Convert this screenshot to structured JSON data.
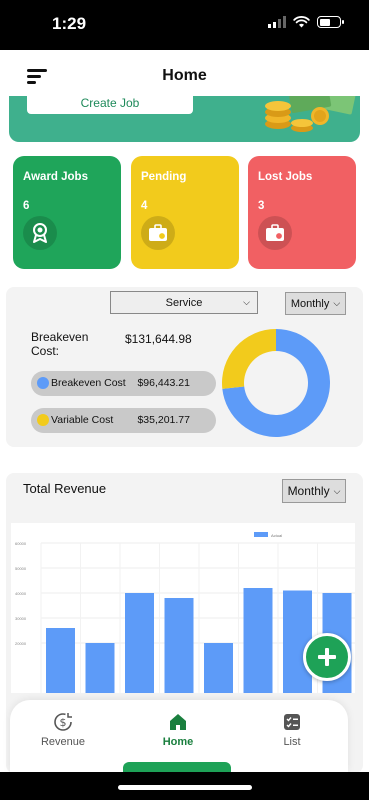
{
  "status_bar": {
    "time": "1:29"
  },
  "header": {
    "title": "Home"
  },
  "banner": {
    "create_job_label": "Create Job"
  },
  "cards": [
    {
      "title": "Award Jobs",
      "count": "6",
      "color": "#1fa55a",
      "icon": "award-icon"
    },
    {
      "title": "Pending",
      "count": "4",
      "color": "#f2cb1c",
      "icon": "briefcase-clock-icon"
    },
    {
      "title": "Lost Jobs",
      "count": "3",
      "color": "#f16063",
      "icon": "briefcase-x-icon"
    }
  ],
  "breakeven": {
    "service_select": "Service",
    "period_select": "Monthly",
    "label": "Breakeven Cost:",
    "total": "$131,644.98",
    "items": [
      {
        "label": "Breakeven Cost",
        "value": "$96,443.21",
        "color": "#5d9bf8"
      },
      {
        "label": "Variable Cost",
        "value": "$35,201.77",
        "color": "#f2cb1c"
      }
    ]
  },
  "donut": {
    "segments": [
      {
        "value": 96443.21,
        "color": "#5d9bf8"
      },
      {
        "value": 35201.77,
        "color": "#f2cb1c"
      }
    ]
  },
  "revenue": {
    "title": "Total Revenue",
    "period_select": "Monthly"
  },
  "chart_data": {
    "type": "bar",
    "legend": [
      "Actual"
    ],
    "legend_position": "top",
    "ytick_labels": [
      "60000",
      "50000",
      "40000",
      "30000",
      "20000"
    ],
    "ylim": [
      0,
      60000
    ],
    "grid": true,
    "series": [
      {
        "name": "Actual",
        "color": "#5d9bf8",
        "values": [
          26000,
          20000,
          40000,
          38000,
          20000,
          42000,
          41000,
          40000,
          36000
        ]
      }
    ]
  },
  "tabbar": {
    "items": [
      {
        "label": "Revenue",
        "icon": "dollar-refresh-icon"
      },
      {
        "label": "Home",
        "icon": "home-icon"
      },
      {
        "label": "List",
        "icon": "checklist-icon"
      }
    ],
    "active": "Home"
  }
}
